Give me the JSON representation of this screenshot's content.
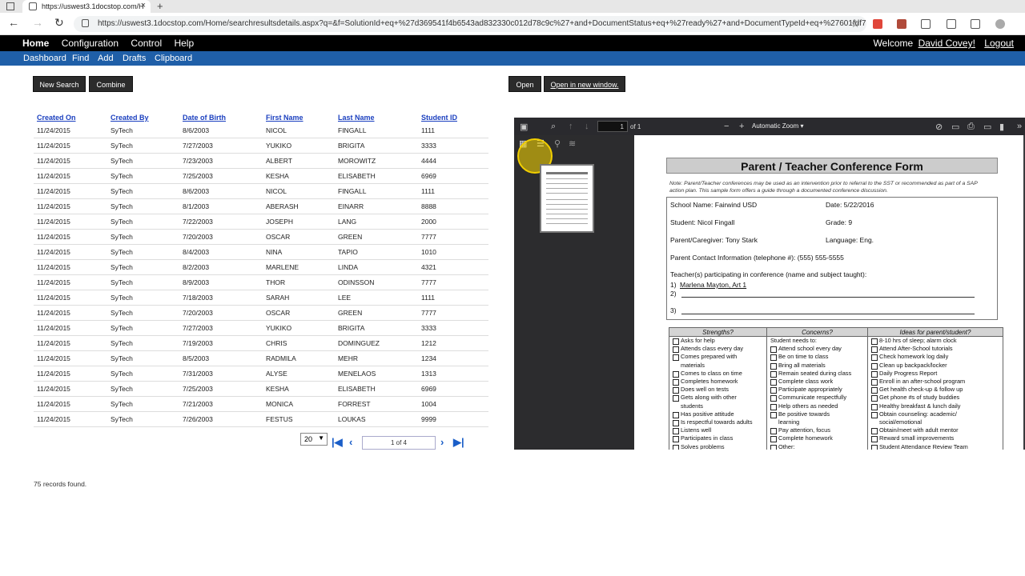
{
  "browser": {
    "tab_title": "https://uswest3.1docstop.com/H",
    "url": "https://uswest3.1docstop.com/Home/searchresultsdetails.aspx?q=&f=SolutionId+eq+%27d369541f4b6543ad832330c012d78c9c%27+and+DocumentStatus+eq+%27ready%27+and+DocumentTypeId+eq+%27601fdf7..."
  },
  "app_menu": {
    "home": "Home",
    "configuration": "Configuration",
    "control": "Control",
    "help": "Help",
    "welcome_text": "Welcome",
    "user_name": "David Covey!",
    "logout": "Logout"
  },
  "sub_menu": [
    "Dashboard",
    "Find",
    "Add",
    "Drafts",
    "Clipboard"
  ],
  "actions": {
    "new_search": "New Search",
    "combine": "Combine",
    "open": "Open",
    "open_new_window": "Open in new window."
  },
  "table": {
    "columns": [
      "Created On",
      "Created By",
      "Date of Birth",
      "First Name",
      "Last Name",
      "Student ID"
    ],
    "rows": [
      [
        "11/24/2015",
        "SyTech",
        "8/6/2003",
        "NICOL",
        "FINGALL",
        "1111"
      ],
      [
        "11/24/2015",
        "SyTech",
        "7/27/2003",
        "YUKIKO",
        "BRIGITA",
        "3333"
      ],
      [
        "11/24/2015",
        "SyTech",
        "7/23/2003",
        "ALBERT",
        "MOROWITZ",
        "4444"
      ],
      [
        "11/24/2015",
        "SyTech",
        "7/25/2003",
        "KESHA",
        "ELISABETH",
        "6969"
      ],
      [
        "11/24/2015",
        "SyTech",
        "8/6/2003",
        "NICOL",
        "FINGALL",
        "1111"
      ],
      [
        "11/24/2015",
        "SyTech",
        "8/1/2003",
        "ABERASH",
        "EINARR",
        "8888"
      ],
      [
        "11/24/2015",
        "SyTech",
        "7/22/2003",
        "JOSEPH",
        "LANG",
        "2000"
      ],
      [
        "11/24/2015",
        "SyTech",
        "7/20/2003",
        "OSCAR",
        "GREEN",
        "7777"
      ],
      [
        "11/24/2015",
        "SyTech",
        "8/4/2003",
        "NINA",
        "TAPIO",
        "1010"
      ],
      [
        "11/24/2015",
        "SyTech",
        "8/2/2003",
        "MARLENE",
        "LINDA",
        "4321"
      ],
      [
        "11/24/2015",
        "SyTech",
        "8/9/2003",
        "THOR",
        "ODINSSON",
        "7777"
      ],
      [
        "11/24/2015",
        "SyTech",
        "7/18/2003",
        "SARAH",
        "LEE",
        "1111"
      ],
      [
        "11/24/2015",
        "SyTech",
        "7/20/2003",
        "OSCAR",
        "GREEN",
        "7777"
      ],
      [
        "11/24/2015",
        "SyTech",
        "7/27/2003",
        "YUKIKO",
        "BRIGITA",
        "3333"
      ],
      [
        "11/24/2015",
        "SyTech",
        "7/19/2003",
        "CHRIS",
        "DOMINGUEZ",
        "1212"
      ],
      [
        "11/24/2015",
        "SyTech",
        "8/5/2003",
        "RADMILA",
        "MEHR",
        "1234"
      ],
      [
        "11/24/2015",
        "SyTech",
        "7/31/2003",
        "ALYSE",
        "MENELAOS",
        "1313"
      ],
      [
        "11/24/2015",
        "SyTech",
        "7/25/2003",
        "KESHA",
        "ELISABETH",
        "6969"
      ],
      [
        "11/24/2015",
        "SyTech",
        "7/21/2003",
        "MONICA",
        "FORREST",
        "1004"
      ],
      [
        "11/24/2015",
        "SyTech",
        "7/26/2003",
        "FESTUS",
        "LOUKAS",
        "9999"
      ]
    ]
  },
  "pager": {
    "page_size": "20",
    "page_label": "1 of 4"
  },
  "records_found": "75 records found.",
  "viewer": {
    "page_number": "1",
    "page_of": "of 1",
    "zoom": "Automatic Zoom"
  },
  "form": {
    "title": "Parent / Teacher Conference Form",
    "note": "Note: Parent/Teacher conferences may be used as an intervention prior to referral to the SST or recommended as part of a SAP action plan.  This sample form offers a guide through a documented conference discussion.",
    "school": "School Name:  Fairwind USD",
    "date": "Date:  5/22/2016",
    "student": "Student: Nicol Fingall",
    "grade": "Grade: 9",
    "parent": "Parent/Caregiver: Tony Stark",
    "language": "Language: Eng.",
    "contact": "Parent Contact Information (telephone #): (555) 555-5555",
    "teachers_label": "Teacher(s) participating in conference (name and subject taught):",
    "teacher1_num": "1)",
    "teacher1": "Marlena Mayton, Art 1",
    "teacher2_num": "2)",
    "teacher3_num": "3)",
    "col_strengths": "Strengths?",
    "col_concerns": "Concerns?",
    "col_ideas": "Ideas for parent/student?",
    "strengths": [
      "Asks for help",
      "Attends class every day",
      "Comes prepared with",
      "materials",
      "Comes to class on time",
      "Completes homework",
      "Does well on tests",
      "Gets along with other",
      "students",
      "Has positive attitude",
      "Is respectful towards adults",
      "Listens well",
      "Participates in class",
      "Solves problems"
    ],
    "concerns_header": "Student needs to:",
    "concerns": [
      "Attend school every day",
      "Be on time to class",
      "Bring all materials",
      "Remain seated during class",
      "Complete class work",
      "Participate appropriately",
      "Communicate respectfully",
      "Help others as needed",
      "Be positive towards",
      "learning",
      "Pay attention, focus",
      "Complete homework",
      "Other:"
    ],
    "ideas": [
      "8-10 hrs of sleep; alarm clock",
      "Attend After-School tutorials",
      "Check homework log daily",
      "Clean up backpack/locker",
      "Daily Progress Report",
      "Enroll in an after-school program",
      "Get health check-up & follow up",
      "Get phone #s of study buddies",
      "Healthy breakfast & lunch daily",
      "Obtain counseling: academic/",
      "social/emotional",
      "Obtain/meet with adult mentor",
      "Reward small improvements",
      "Student Attendance Review Team"
    ]
  }
}
